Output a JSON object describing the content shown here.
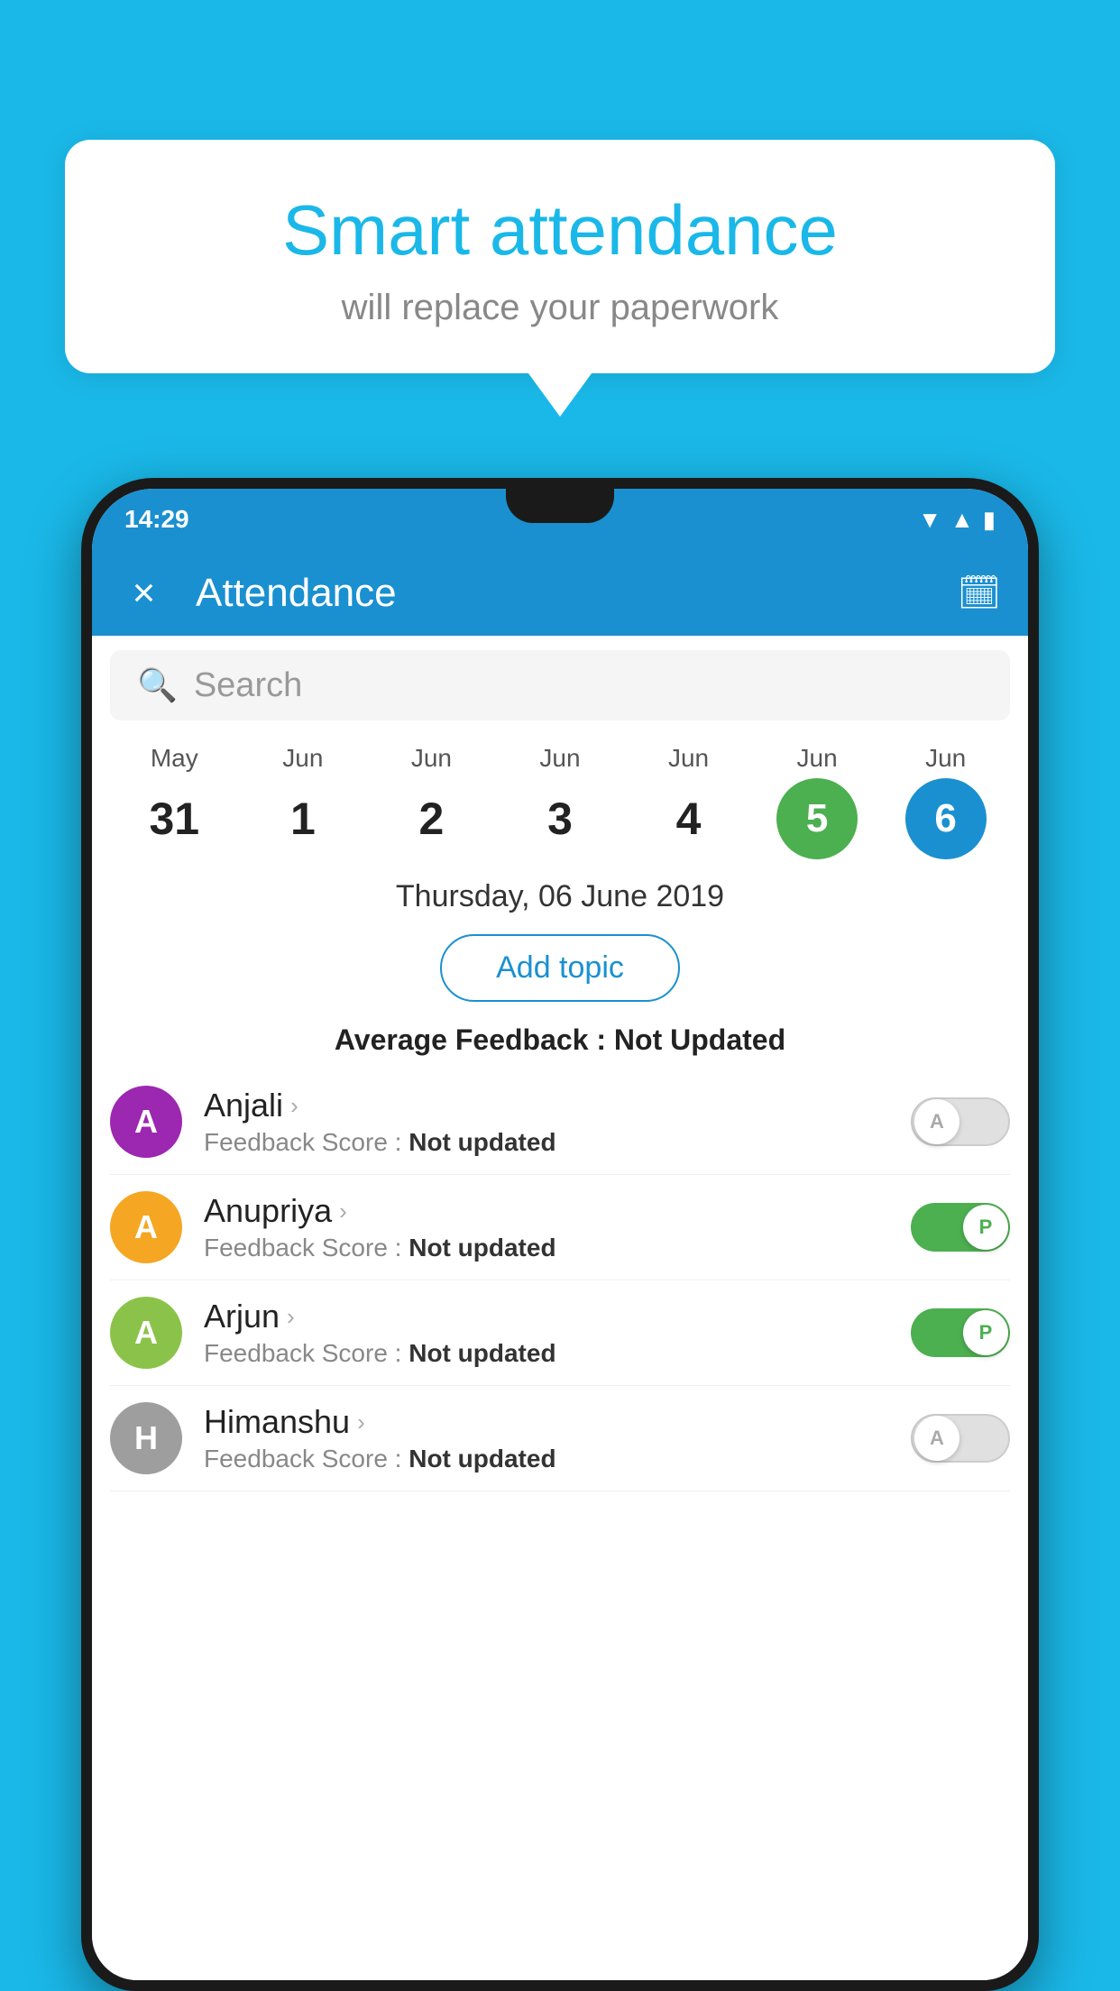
{
  "background_color": "#1ab8e8",
  "bubble": {
    "title": "Smart attendance",
    "subtitle": "will replace your paperwork"
  },
  "status_bar": {
    "time": "14:29"
  },
  "app_bar": {
    "title": "Attendance",
    "close_label": "×",
    "calendar_icon": "📅"
  },
  "search": {
    "placeholder": "Search"
  },
  "dates": [
    {
      "month": "May",
      "day": "31",
      "style": "normal"
    },
    {
      "month": "Jun",
      "day": "1",
      "style": "normal"
    },
    {
      "month": "Jun",
      "day": "2",
      "style": "normal"
    },
    {
      "month": "Jun",
      "day": "3",
      "style": "normal"
    },
    {
      "month": "Jun",
      "day": "4",
      "style": "normal"
    },
    {
      "month": "Jun",
      "day": "5",
      "style": "today"
    },
    {
      "month": "Jun",
      "day": "6",
      "style": "selected"
    }
  ],
  "selected_date": "Thursday, 06 June 2019",
  "add_topic_label": "Add topic",
  "avg_feedback_label": "Average Feedback : ",
  "avg_feedback_value": "Not Updated",
  "students": [
    {
      "name": "Anjali",
      "avatar_letter": "A",
      "avatar_color": "#9c27b0",
      "feedback_label": "Feedback Score : ",
      "feedback_value": "Not updated",
      "toggle": "off",
      "toggle_letter": "A"
    },
    {
      "name": "Anupriya",
      "avatar_letter": "A",
      "avatar_color": "#f5a623",
      "feedback_label": "Feedback Score : ",
      "feedback_value": "Not updated",
      "toggle": "on",
      "toggle_letter": "P"
    },
    {
      "name": "Arjun",
      "avatar_letter": "A",
      "avatar_color": "#8bc34a",
      "feedback_label": "Feedback Score : ",
      "feedback_value": "Not updated",
      "toggle": "on",
      "toggle_letter": "P"
    },
    {
      "name": "Himanshu",
      "avatar_letter": "H",
      "avatar_color": "#9e9e9e",
      "feedback_label": "Feedback Score : ",
      "feedback_value": "Not updated",
      "toggle": "off",
      "toggle_letter": "A"
    }
  ]
}
